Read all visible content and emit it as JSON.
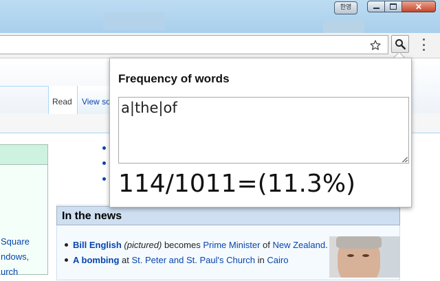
{
  "window": {
    "ime_label": "한영",
    "close_glyph": "✕"
  },
  "browser": {
    "address": "",
    "star_icon": "star-icon",
    "extension_icon": "search-icon",
    "menu_icon": "more-vert-icon"
  },
  "wiki": {
    "tabs": [
      {
        "label": "Read"
      },
      {
        "label": "View so"
      }
    ],
    "left_links": [
      "Square",
      "ndows,",
      "urch"
    ],
    "news": {
      "title": "In the news",
      "items": [
        {
          "parts": [
            {
              "t": "Bill English",
              "style": "link-bold"
            },
            {
              "t": " ",
              "style": "text"
            },
            {
              "t": "(pictured)",
              "style": "italic"
            },
            {
              "t": " becomes ",
              "style": "text"
            },
            {
              "t": "Prime Minister",
              "style": "link"
            },
            {
              "t": " of ",
              "style": "text"
            },
            {
              "t": "New Zealand",
              "style": "link"
            },
            {
              "t": ".",
              "style": "text"
            }
          ]
        },
        {
          "parts": [
            {
              "t": "A bombing",
              "style": "link-bold"
            },
            {
              "t": " at ",
              "style": "text"
            },
            {
              "t": "St. Peter and St. Paul's Church",
              "style": "link"
            },
            {
              "t": " in ",
              "style": "text"
            },
            {
              "t": "Cairo",
              "style": "link"
            }
          ]
        }
      ]
    }
  },
  "popup": {
    "title": "Frequency of words",
    "input_value": "a|the|of",
    "result": "114/1011=(11.3%)"
  },
  "colors": {
    "titlebar": "#b4d5ef",
    "link": "#0645ad",
    "news_header": "#cedff2"
  }
}
